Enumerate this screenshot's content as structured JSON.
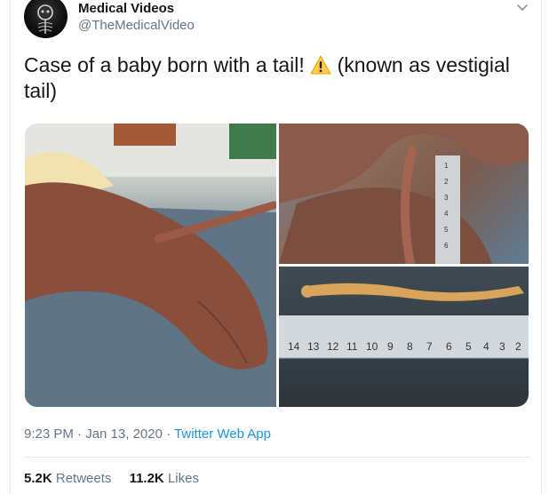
{
  "author": {
    "display_name": "Medical Videos",
    "handle": "@TheMedicalVideo",
    "avatar_icon": "skeleton-avatar-icon"
  },
  "tweet": {
    "text_before_icon": "Case of a baby born with a tail! ",
    "warning_icon": "warning-emoji-icon",
    "text_after_icon": " (known as vestigial tail)"
  },
  "media": {
    "images": [
      {
        "name": "baby-tail-photo-1"
      },
      {
        "name": "baby-tail-ruler-photo-2"
      },
      {
        "name": "tail-on-ruler-photo-3"
      }
    ],
    "ruler_numbers_side": [
      "1",
      "2",
      "3",
      "4",
      "5",
      "6"
    ],
    "ruler_numbers_bottom": [
      "14",
      "13",
      "12",
      "11",
      "10",
      "9",
      "8",
      "7",
      "6",
      "5",
      "4",
      "3",
      "2"
    ]
  },
  "meta": {
    "time": "9:23 PM",
    "separator1": " · ",
    "date": "Jan 13, 2020",
    "separator2": " · ",
    "app": "Twitter Web App"
  },
  "stats": {
    "retweets_count": "5.2K",
    "retweets_label": "Retweets",
    "likes_count": "11.2K",
    "likes_label": "Likes"
  },
  "colors": {
    "link": "#1b95e0",
    "secondary_text": "#657786",
    "primary_text": "#14171a",
    "border": "#e6ecf0"
  }
}
